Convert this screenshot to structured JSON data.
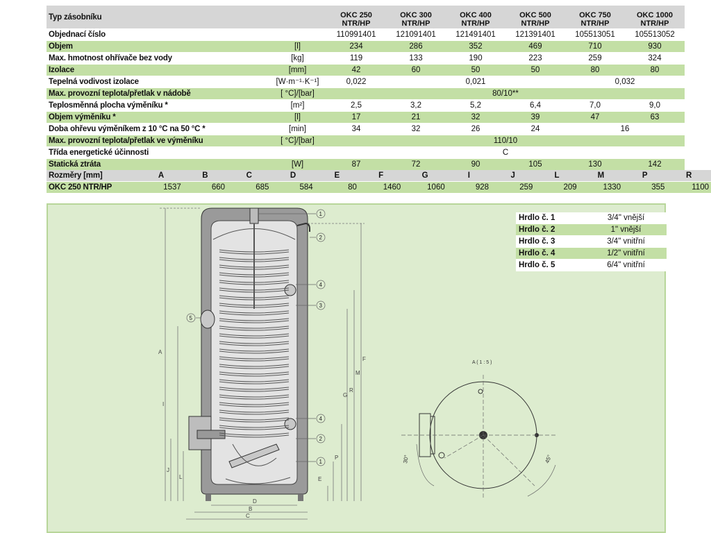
{
  "spec": {
    "header": {
      "label": "Typ zásobníku",
      "unit": "",
      "models": [
        "OKC 250\nNTR/HP",
        "OKC 300\nNTR/HP",
        "OKC 400\nNTR/HP",
        "OKC 500\nNTR/HP",
        "OKC 750\nNTR/HP",
        "OKC 1000\nNTR/HP"
      ]
    },
    "rows": [
      {
        "label": "Objednací číslo",
        "unit": "",
        "cells": [
          [
            "110991401",
            1
          ],
          [
            "121091401",
            1
          ],
          [
            "121491401",
            1
          ],
          [
            "121391401",
            1
          ],
          [
            "105513051",
            1
          ],
          [
            "105513052",
            1
          ]
        ]
      },
      {
        "label": "Objem",
        "unit": "[l]",
        "cells": [
          [
            "234",
            1
          ],
          [
            "286",
            1
          ],
          [
            "352",
            1
          ],
          [
            "469",
            1
          ],
          [
            "710",
            1
          ],
          [
            "930",
            1
          ]
        ]
      },
      {
        "label": "Max. hmotnost ohřívače bez vody",
        "unit": "[kg]",
        "cells": [
          [
            "119",
            1
          ],
          [
            "133",
            1
          ],
          [
            "190",
            1
          ],
          [
            "223",
            1
          ],
          [
            "259",
            1
          ],
          [
            "324",
            1
          ]
        ]
      },
      {
        "label": "Izolace",
        "unit": "[mm]",
        "cells": [
          [
            "42",
            1
          ],
          [
            "60",
            1
          ],
          [
            "50",
            1
          ],
          [
            "50",
            1
          ],
          [
            "80",
            1
          ],
          [
            "80",
            1
          ]
        ]
      },
      {
        "label": "Tepelná vodivost izolace",
        "unit": "[W·m⁻¹·K⁻¹]",
        "cells": [
          [
            "0,022",
            1
          ],
          [
            "0,021",
            3
          ],
          [
            "0,032",
            2
          ]
        ]
      },
      {
        "label": "Max. provozní teplota/přetlak v nádobě",
        "unit": "[ °C]/[bar]",
        "cells": [
          [
            "80/10**",
            6
          ]
        ]
      },
      {
        "label": "Teplosměnná plocha výměníku *",
        "unit": "[m²]",
        "cells": [
          [
            "2,5",
            1
          ],
          [
            "3,2",
            1
          ],
          [
            "5,2",
            1
          ],
          [
            "6,4",
            1
          ],
          [
            "7,0",
            1
          ],
          [
            "9,0",
            1
          ]
        ]
      },
      {
        "label": "Objem výměníku *",
        "unit": "[l]",
        "cells": [
          [
            "17",
            1
          ],
          [
            "21",
            1
          ],
          [
            "32",
            1
          ],
          [
            "39",
            1
          ],
          [
            "47",
            1
          ],
          [
            "63",
            1
          ]
        ]
      },
      {
        "label": "Doba ohřevu výměníkem z 10 °C na 50 °C *",
        "unit": "[min]",
        "cells": [
          [
            "34",
            1
          ],
          [
            "32",
            1
          ],
          [
            "26",
            1
          ],
          [
            "24",
            1
          ],
          [
            "16",
            2
          ]
        ]
      },
      {
        "label": "Max. provozní teplota/přetlak ve výměníku",
        "unit": "[ °C]/[bar]",
        "cells": [
          [
            "110/10",
            6
          ]
        ]
      },
      {
        "label": "Třída energetické účinnosti",
        "unit": "",
        "cells": [
          [
            "C",
            6
          ]
        ]
      },
      {
        "label": "Statická ztráta",
        "unit": "[W]",
        "cells": [
          [
            "87",
            1
          ],
          [
            "72",
            1
          ],
          [
            "90",
            1
          ],
          [
            "105",
            1
          ],
          [
            "130",
            1
          ],
          [
            "142",
            1
          ]
        ]
      }
    ]
  },
  "dimensions": {
    "header": [
      "Rozměry [mm]",
      "A",
      "B",
      "C",
      "D",
      "E",
      "F",
      "G",
      "I",
      "J",
      "L",
      "M",
      "P",
      "R"
    ],
    "row": [
      "OKC 250 NTR/HP",
      "1537",
      "660",
      "685",
      "584",
      "80",
      "1460",
      "1060",
      "928",
      "259",
      "209",
      "1330",
      "355",
      "1100"
    ]
  },
  "connections": [
    {
      "name": "Hrdlo č. 1",
      "value": "3/4\" vnější"
    },
    {
      "name": "Hrdlo č. 2",
      "value": "1\" vnější"
    },
    {
      "name": "Hrdlo č. 3",
      "value": "3/4\" vnitřní"
    },
    {
      "name": "Hrdlo č. 4",
      "value": "1/2\" vnitřní"
    },
    {
      "name": "Hrdlo č. 5",
      "value": "6/4\" vnitřní"
    }
  ],
  "drawing": {
    "callouts_right": [
      "1",
      "2",
      "4",
      "3",
      "4",
      "2",
      "1"
    ],
    "callout_left": "5",
    "dim_letters_vertical_left": [
      "A",
      "I",
      "J",
      "L"
    ],
    "dim_letters_vertical_right": [
      "G",
      "R",
      "M",
      "F"
    ],
    "dim_letters_bottom": [
      "D",
      "B",
      "C"
    ],
    "dim_letters_small": [
      "E",
      "P"
    ],
    "top_view_label": "A ( 1 : 5 )",
    "angle_left": "30°",
    "angle_right": "45°"
  },
  "colors": {
    "green_row": "#c3dfa5",
    "header_gray": "#d6d6d6",
    "panel_bg": "#ddeccf",
    "panel_border": "#b8d69a"
  }
}
